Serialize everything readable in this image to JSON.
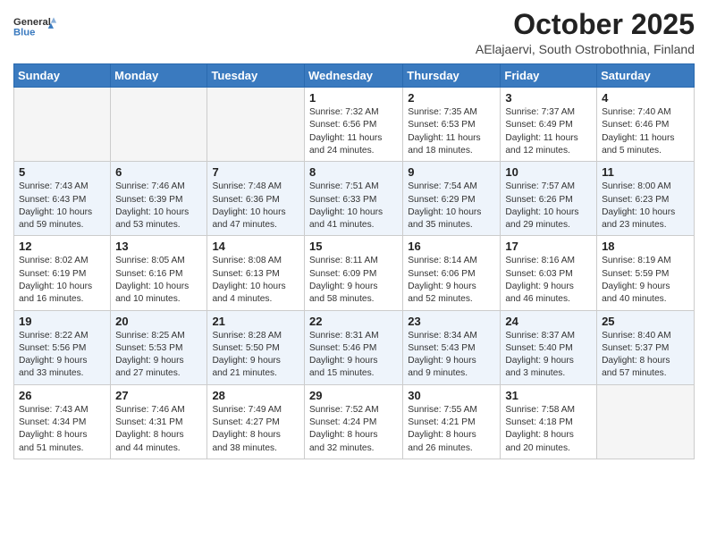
{
  "header": {
    "logo_general": "General",
    "logo_blue": "Blue",
    "month_title": "October 2025",
    "subtitle": "AElajaervi, South Ostrobothnia, Finland"
  },
  "calendar": {
    "days_of_week": [
      "Sunday",
      "Monday",
      "Tuesday",
      "Wednesday",
      "Thursday",
      "Friday",
      "Saturday"
    ],
    "weeks": [
      [
        {
          "day": "",
          "info": ""
        },
        {
          "day": "",
          "info": ""
        },
        {
          "day": "",
          "info": ""
        },
        {
          "day": "1",
          "info": "Sunrise: 7:32 AM\nSunset: 6:56 PM\nDaylight: 11 hours\nand 24 minutes."
        },
        {
          "day": "2",
          "info": "Sunrise: 7:35 AM\nSunset: 6:53 PM\nDaylight: 11 hours\nand 18 minutes."
        },
        {
          "day": "3",
          "info": "Sunrise: 7:37 AM\nSunset: 6:49 PM\nDaylight: 11 hours\nand 12 minutes."
        },
        {
          "day": "4",
          "info": "Sunrise: 7:40 AM\nSunset: 6:46 PM\nDaylight: 11 hours\nand 5 minutes."
        }
      ],
      [
        {
          "day": "5",
          "info": "Sunrise: 7:43 AM\nSunset: 6:43 PM\nDaylight: 10 hours\nand 59 minutes."
        },
        {
          "day": "6",
          "info": "Sunrise: 7:46 AM\nSunset: 6:39 PM\nDaylight: 10 hours\nand 53 minutes."
        },
        {
          "day": "7",
          "info": "Sunrise: 7:48 AM\nSunset: 6:36 PM\nDaylight: 10 hours\nand 47 minutes."
        },
        {
          "day": "8",
          "info": "Sunrise: 7:51 AM\nSunset: 6:33 PM\nDaylight: 10 hours\nand 41 minutes."
        },
        {
          "day": "9",
          "info": "Sunrise: 7:54 AM\nSunset: 6:29 PM\nDaylight: 10 hours\nand 35 minutes."
        },
        {
          "day": "10",
          "info": "Sunrise: 7:57 AM\nSunset: 6:26 PM\nDaylight: 10 hours\nand 29 minutes."
        },
        {
          "day": "11",
          "info": "Sunrise: 8:00 AM\nSunset: 6:23 PM\nDaylight: 10 hours\nand 23 minutes."
        }
      ],
      [
        {
          "day": "12",
          "info": "Sunrise: 8:02 AM\nSunset: 6:19 PM\nDaylight: 10 hours\nand 16 minutes."
        },
        {
          "day": "13",
          "info": "Sunrise: 8:05 AM\nSunset: 6:16 PM\nDaylight: 10 hours\nand 10 minutes."
        },
        {
          "day": "14",
          "info": "Sunrise: 8:08 AM\nSunset: 6:13 PM\nDaylight: 10 hours\nand 4 minutes."
        },
        {
          "day": "15",
          "info": "Sunrise: 8:11 AM\nSunset: 6:09 PM\nDaylight: 9 hours\nand 58 minutes."
        },
        {
          "day": "16",
          "info": "Sunrise: 8:14 AM\nSunset: 6:06 PM\nDaylight: 9 hours\nand 52 minutes."
        },
        {
          "day": "17",
          "info": "Sunrise: 8:16 AM\nSunset: 6:03 PM\nDaylight: 9 hours\nand 46 minutes."
        },
        {
          "day": "18",
          "info": "Sunrise: 8:19 AM\nSunset: 5:59 PM\nDaylight: 9 hours\nand 40 minutes."
        }
      ],
      [
        {
          "day": "19",
          "info": "Sunrise: 8:22 AM\nSunset: 5:56 PM\nDaylight: 9 hours\nand 33 minutes."
        },
        {
          "day": "20",
          "info": "Sunrise: 8:25 AM\nSunset: 5:53 PM\nDaylight: 9 hours\nand 27 minutes."
        },
        {
          "day": "21",
          "info": "Sunrise: 8:28 AM\nSunset: 5:50 PM\nDaylight: 9 hours\nand 21 minutes."
        },
        {
          "day": "22",
          "info": "Sunrise: 8:31 AM\nSunset: 5:46 PM\nDaylight: 9 hours\nand 15 minutes."
        },
        {
          "day": "23",
          "info": "Sunrise: 8:34 AM\nSunset: 5:43 PM\nDaylight: 9 hours\nand 9 minutes."
        },
        {
          "day": "24",
          "info": "Sunrise: 8:37 AM\nSunset: 5:40 PM\nDaylight: 9 hours\nand 3 minutes."
        },
        {
          "day": "25",
          "info": "Sunrise: 8:40 AM\nSunset: 5:37 PM\nDaylight: 8 hours\nand 57 minutes."
        }
      ],
      [
        {
          "day": "26",
          "info": "Sunrise: 7:43 AM\nSunset: 4:34 PM\nDaylight: 8 hours\nand 51 minutes."
        },
        {
          "day": "27",
          "info": "Sunrise: 7:46 AM\nSunset: 4:31 PM\nDaylight: 8 hours\nand 44 minutes."
        },
        {
          "day": "28",
          "info": "Sunrise: 7:49 AM\nSunset: 4:27 PM\nDaylight: 8 hours\nand 38 minutes."
        },
        {
          "day": "29",
          "info": "Sunrise: 7:52 AM\nSunset: 4:24 PM\nDaylight: 8 hours\nand 32 minutes."
        },
        {
          "day": "30",
          "info": "Sunrise: 7:55 AM\nSunset: 4:21 PM\nDaylight: 8 hours\nand 26 minutes."
        },
        {
          "day": "31",
          "info": "Sunrise: 7:58 AM\nSunset: 4:18 PM\nDaylight: 8 hours\nand 20 minutes."
        },
        {
          "day": "",
          "info": ""
        }
      ]
    ]
  }
}
